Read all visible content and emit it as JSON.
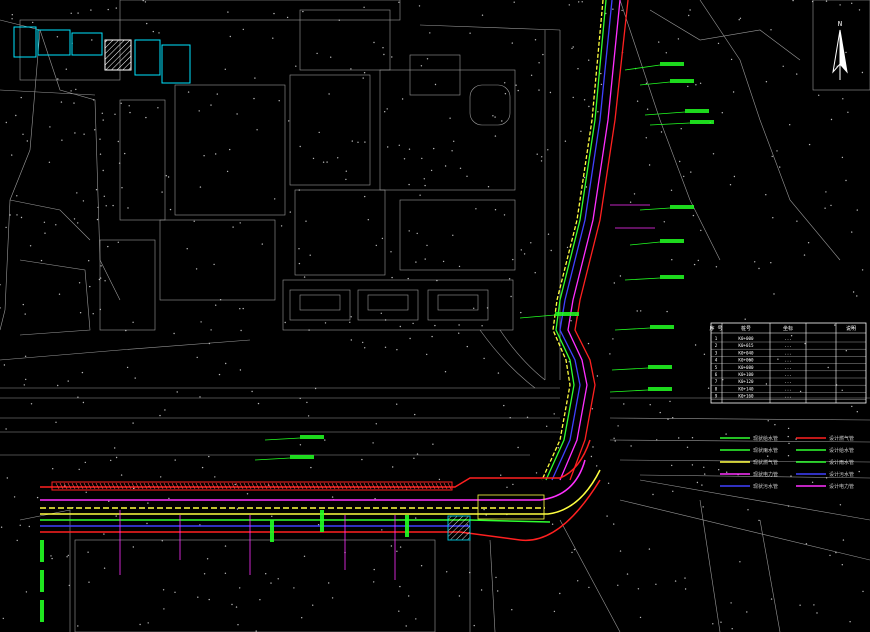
{
  "colors": {
    "background": "#000000",
    "building": "#cfcfcf",
    "road": "#a0a0a0",
    "pipe_red": "#ff2020",
    "pipe_magenta": "#ff30ff",
    "pipe_yellow": "#ffff40",
    "pipe_green": "#30ff30",
    "pipe_blue": "#4040ff",
    "cyan": "#00e5ff",
    "label_green": "#22ff22"
  },
  "north_arrow": {
    "letter": "N"
  },
  "table": {
    "headers": [
      "序 号",
      "桩号",
      "坐标",
      "",
      "说明"
    ],
    "rows": [
      [
        "1",
        "K0+000",
        "..."
      ],
      [
        "2",
        "K0+015",
        "..."
      ],
      [
        "3",
        "K0+040",
        "..."
      ],
      [
        "4",
        "K0+060",
        "..."
      ],
      [
        "5",
        "K0+080",
        "..."
      ],
      [
        "6",
        "K0+100",
        "..."
      ],
      [
        "7",
        "K0+120",
        "..."
      ],
      [
        "8",
        "K0+140",
        "..."
      ],
      [
        "9",
        "K0+160",
        "..."
      ]
    ]
  },
  "legend": [
    {
      "label": "现状给水管",
      "color": "#30ff30"
    },
    {
      "label": "设计燃气管",
      "color": "#ff2020"
    },
    {
      "label": "现状雨水管",
      "color": "#30ff30"
    },
    {
      "label": "设计给水管",
      "color": "#30ff30"
    },
    {
      "label": "现状燃气管",
      "color": "#ffff40"
    },
    {
      "label": "设计雨水管",
      "color": "#30ff30"
    },
    {
      "label": "现状电力管",
      "color": "#ff30ff"
    },
    {
      "label": "设计污水管",
      "color": "#4040ff"
    },
    {
      "label": "现状污水管",
      "color": "#4040ff"
    },
    {
      "label": "设计电力管",
      "color": "#ff30ff"
    }
  ]
}
